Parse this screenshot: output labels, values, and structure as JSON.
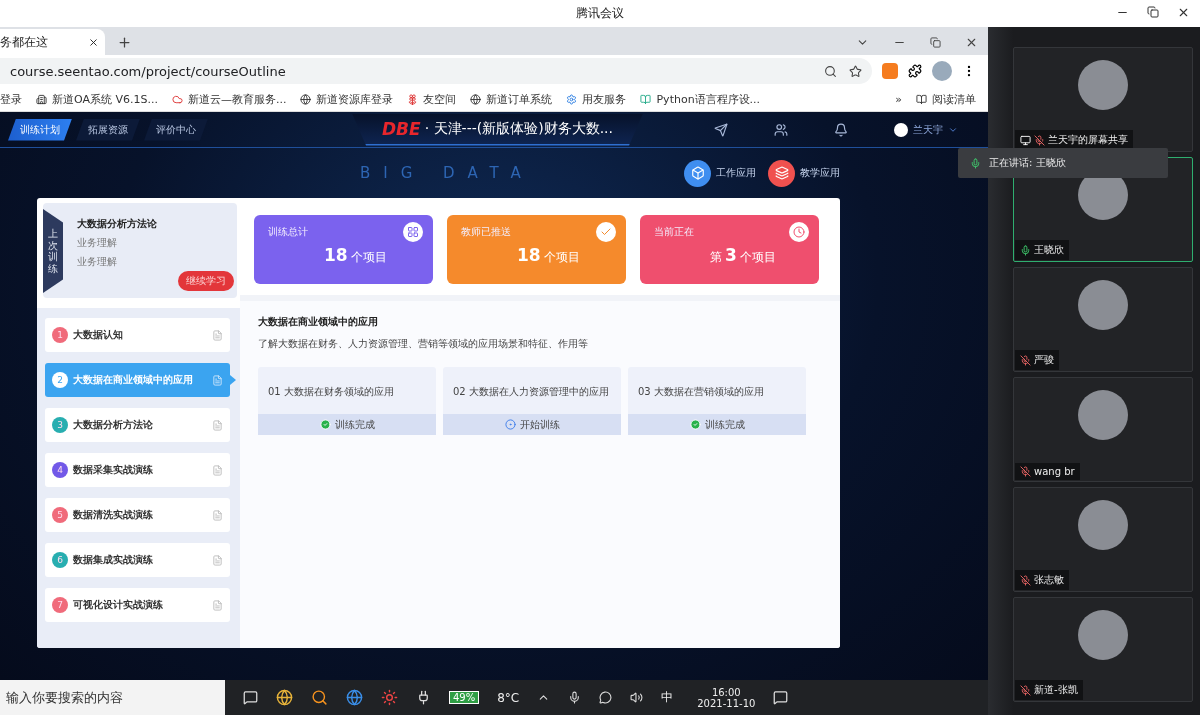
{
  "meeting": {
    "title": "腾讯会议"
  },
  "browser": {
    "tab_title": "务都在这",
    "address": "course.seentao.com/project/courseOutline",
    "bookmarks": [
      {
        "label": "登录",
        "kind": "none"
      },
      {
        "label": "新道OA系统 V6.1S...",
        "kind": "oa"
      },
      {
        "label": "新道云—教育服务...",
        "kind": "cloud"
      },
      {
        "label": "新道资源库登录",
        "kind": "globe"
      },
      {
        "label": "友空间",
        "kind": "flower"
      },
      {
        "label": "新道订单系统",
        "kind": "globe"
      },
      {
        "label": "用友服务",
        "kind": "gear"
      },
      {
        "label": "Python语言程序设...",
        "kind": "book"
      }
    ],
    "overflow": "»",
    "reading_list": "阅读清单"
  },
  "app": {
    "nav_tabs": [
      {
        "label": "训练计划",
        "selected": true
      },
      {
        "label": "拓展资源",
        "selected": false
      },
      {
        "label": "评价中心",
        "selected": false
      }
    ],
    "brand": "DBE",
    "title": "· 天津---(新版体验)财务大数...",
    "user": "兰天宇",
    "banner": "BIG DATA",
    "apps": [
      {
        "label": "工作应用",
        "color": "#3f8ef0"
      },
      {
        "label": "教学应用",
        "color": "#f0514f"
      }
    ],
    "last_training": {
      "label": "上次训练",
      "course": "大数据分析方法论",
      "lines": [
        "业务理解",
        "业务理解"
      ],
      "button": "继续学习"
    },
    "stats": [
      {
        "label": "训练总计",
        "number": "18",
        "unit": "个项目",
        "kind": "grid",
        "color": "#7b62ee"
      },
      {
        "label": "教师已推送",
        "number": "18",
        "unit": "个项目",
        "kind": "check",
        "color": "#f58a2c"
      },
      {
        "label": "当前正在",
        "prefix": "第",
        "number": "3",
        "unit": "个项目",
        "kind": "clock",
        "color": "#ef4f6e"
      }
    ],
    "modules": [
      {
        "number": "1",
        "title": "大数据认知",
        "selected": false,
        "color": "#f06b7b"
      },
      {
        "number": "2",
        "title": "大数据在商业领域中的应用",
        "selected": true,
        "color": "#3ba4f0"
      },
      {
        "number": "3",
        "title": "大数据分析方法论",
        "selected": false,
        "color": "#28aeb0"
      },
      {
        "number": "4",
        "title": "数据采集实战演练",
        "selected": false,
        "color": "#7259e8"
      },
      {
        "number": "5",
        "title": "数据清洗实战演练",
        "selected": false,
        "color": "#f06b7b"
      },
      {
        "number": "6",
        "title": "数据集成实战演练",
        "selected": false,
        "color": "#28aeb0"
      },
      {
        "number": "7",
        "title": "可视化设计实战演练",
        "selected": false,
        "color": "#f06b7b"
      }
    ],
    "detail": {
      "title": "大数据在商业领域中的应用",
      "description": "了解大数据在财务、人力资源管理、营销等领域的应用场景和特征、作用等",
      "lessons": [
        {
          "title": "01 大数据在财务领域的应用",
          "status": "训练完成",
          "kind": "done"
        },
        {
          "title": "02 大数据在人力资源管理中的应用",
          "status": "开始训练",
          "kind": "start"
        },
        {
          "title": "03 大数据在营销领域的应用",
          "status": "训练完成",
          "kind": "done"
        }
      ]
    }
  },
  "taskbar": {
    "search_placeholder": "输入你要搜索的内容",
    "battery": "49%",
    "weather": "8°C",
    "ime": "中",
    "time": "16:00",
    "date": "2021-11-10"
  },
  "speaking_notice": "正在讲话: 王晓欣",
  "participants": [
    {
      "name": "兰天宇的屏幕共享",
      "sharing": true,
      "speaking": false
    },
    {
      "name": "王晓欣",
      "sharing": false,
      "speaking": true
    },
    {
      "name": "严骏",
      "sharing": false,
      "speaking": false
    },
    {
      "name": "wang br",
      "sharing": false,
      "speaking": false
    },
    {
      "name": "张志敏",
      "sharing": false,
      "speaking": false
    },
    {
      "name": "新道-张凯",
      "sharing": false,
      "speaking": false
    }
  ]
}
